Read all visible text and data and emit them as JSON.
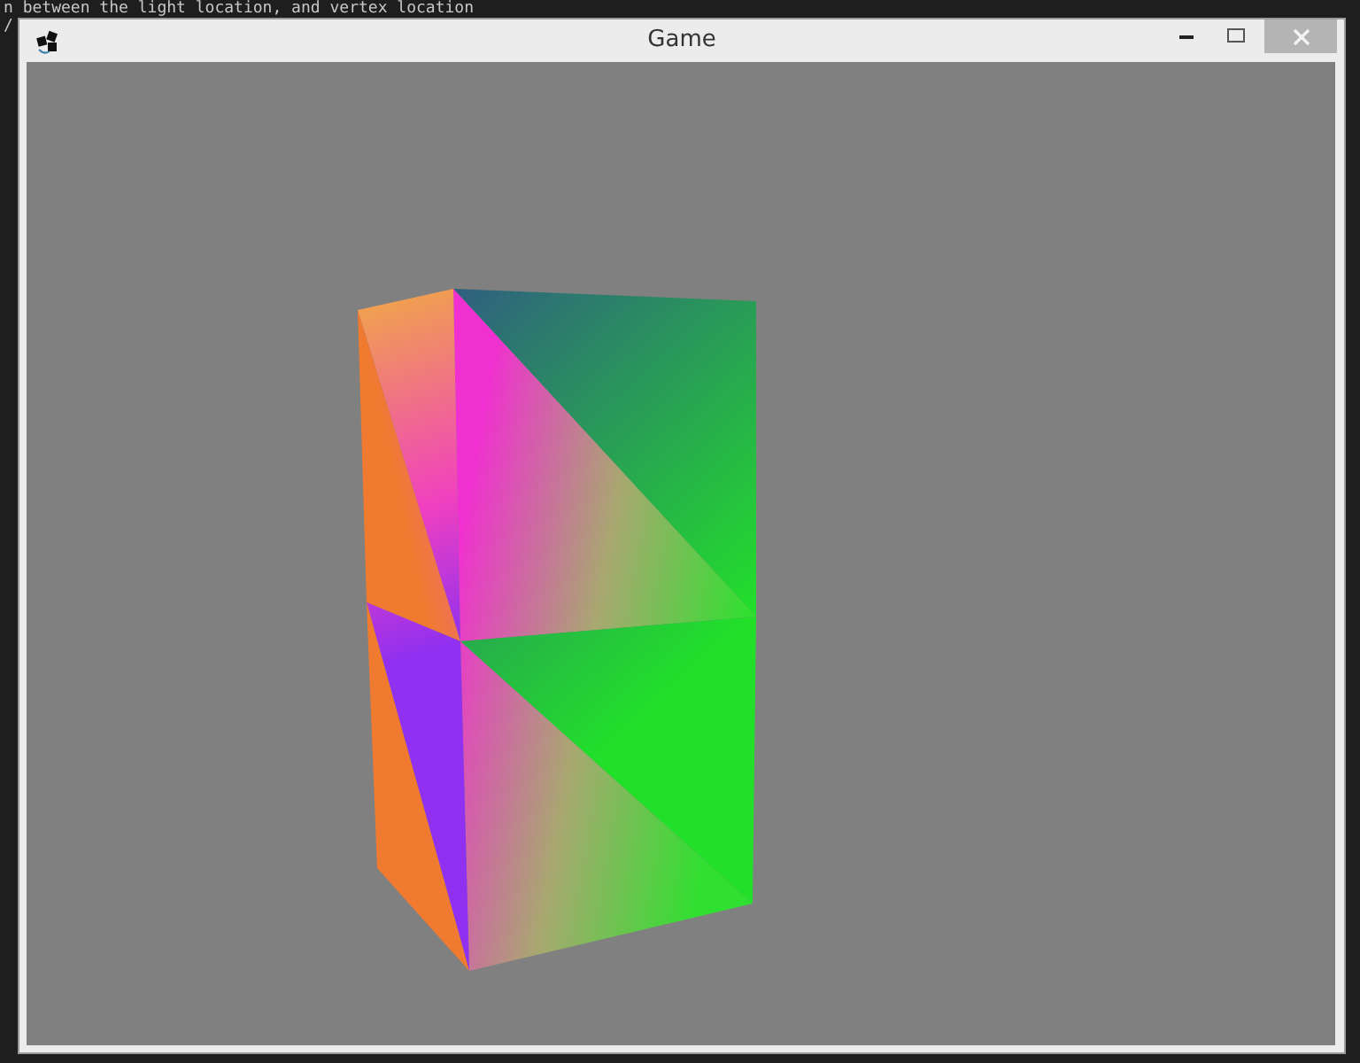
{
  "editor": {
    "lines": [
      "n between the light location, and vertex location",
      "/"
    ]
  },
  "window": {
    "title": "Game",
    "controls": [
      {
        "kind": "minimize"
      },
      {
        "kind": "maximize"
      },
      {
        "kind": "close"
      }
    ]
  }
}
